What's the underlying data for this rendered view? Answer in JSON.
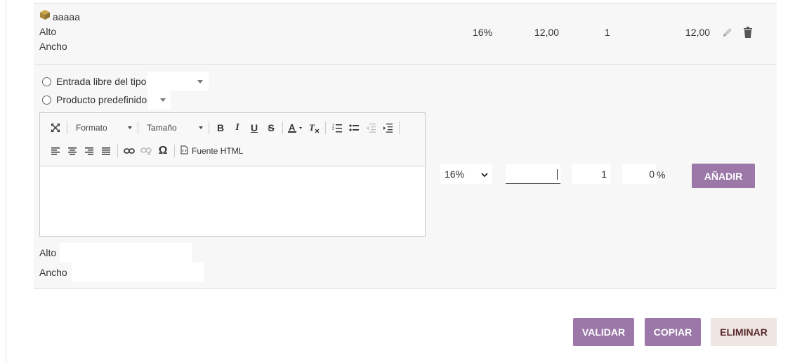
{
  "line": {
    "product_name": "aaaaa",
    "attr1": "Alto",
    "attr2": "Ancho",
    "tax": "16%",
    "price": "12,00",
    "qty": "1",
    "total": "12,00"
  },
  "form": {
    "radio_free": "Entrada libre del tipo",
    "radio_predef": "Producto predefinido",
    "editor": {
      "format_label": "Formato",
      "size_label": "Tamaño",
      "source_label": "Fuente HTML"
    },
    "tax_select": "16%",
    "price_value": "",
    "qty_value": "1",
    "discount_value": "0",
    "percent_sign": "%",
    "add_button": "AÑADIR",
    "alto_label": "Alto",
    "ancho_label": "Ancho"
  },
  "actions": {
    "validate": "VALIDAR",
    "copy": "COPIAR",
    "delete": "ELIMINAR"
  },
  "colors": {
    "primary_button": "#9c78a8",
    "secondary_button": "#eee6e3",
    "secondary_text": "#5a2a2a",
    "row_bg": "#f7f7f7",
    "box_icon": "#b3933c"
  }
}
